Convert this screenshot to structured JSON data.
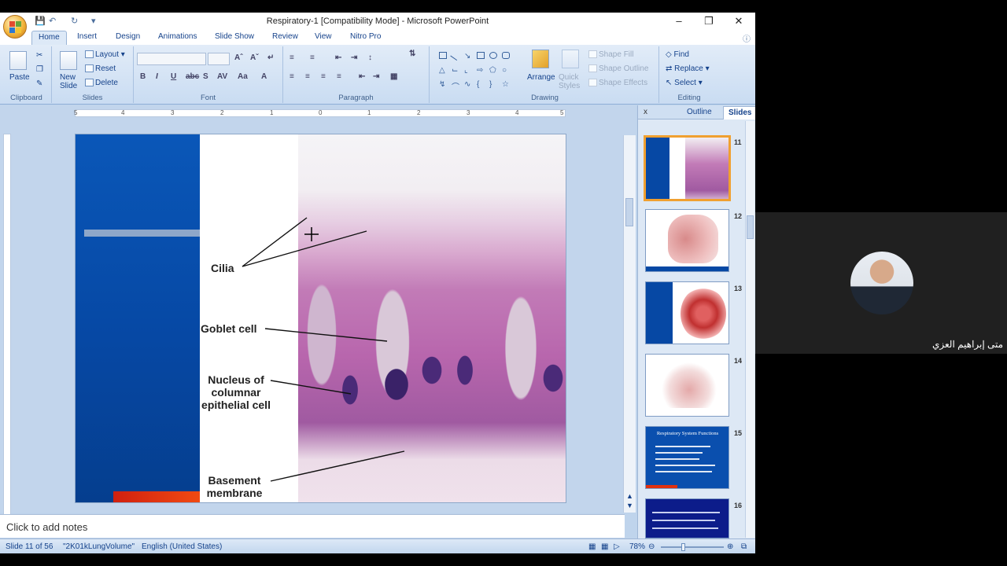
{
  "window": {
    "title": "Respiratory-1 [Compatibility Mode] - Microsoft PowerPoint"
  },
  "tabs": [
    "Home",
    "Insert",
    "Design",
    "Animations",
    "Slide Show",
    "Review",
    "View",
    "Nitro Pro"
  ],
  "ribbon": {
    "clipboard": {
      "label": "Clipboard",
      "paste": "Paste"
    },
    "slides": {
      "label": "Slides",
      "new_slide": "New Slide",
      "layout": "Layout",
      "reset": "Reset",
      "delete": "Delete"
    },
    "font": {
      "label": "Font"
    },
    "paragraph": {
      "label": "Paragraph"
    },
    "drawing": {
      "label": "Drawing",
      "arrange": "Arrange",
      "quick_styles": "Quick Styles",
      "shape_fill": "Shape Fill",
      "shape_outline": "Shape Outline",
      "shape_effects": "Shape Effects"
    },
    "editing": {
      "label": "Editing",
      "find": "Find",
      "replace": "Replace",
      "select": "Select"
    }
  },
  "ruler_numbers": [
    "5",
    "4",
    "3",
    "2",
    "1",
    "0",
    "1",
    "2",
    "3",
    "4",
    "5"
  ],
  "slide": {
    "labels": {
      "cilia": "Cilia",
      "goblet": "Goblet cell",
      "nucleus": "Nucleus of columnar epithelial cell",
      "basement": "Basement membrane"
    }
  },
  "notes_placeholder": "Click to add notes",
  "panel": {
    "tab_outline": "Outline",
    "tab_slides": "Slides",
    "close": "x",
    "thumb_numbers": [
      "11",
      "12",
      "13",
      "14",
      "15",
      "16"
    ],
    "thumb15_title": "Respiratory System Functions"
  },
  "status": {
    "slide_info": "Slide 11 of 56",
    "theme": "\"2K01kLungVolume\"",
    "language": "English (United States)",
    "zoom": "78%"
  },
  "participant": {
    "name": "متى إبراهيم العزي"
  },
  "colors": {
    "slide_blue": "#0648a4",
    "accent_red": "#e0300f",
    "ribbon_bg": "#c9dcf2"
  }
}
